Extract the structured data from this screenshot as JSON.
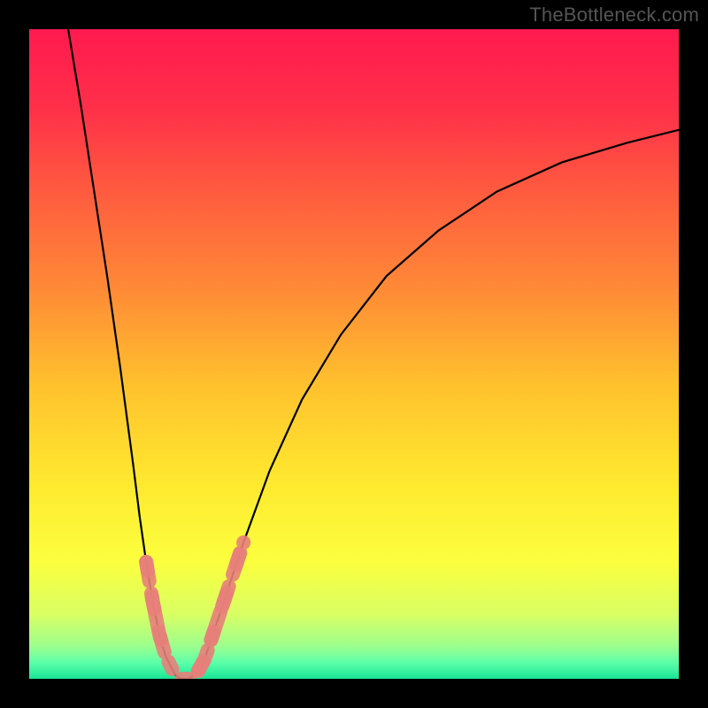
{
  "watermark": "TheBottleneck.com",
  "gradient_stops": [
    {
      "offset": 0.0,
      "color": "#ff1a4f"
    },
    {
      "offset": 0.12,
      "color": "#ff2f49"
    },
    {
      "offset": 0.25,
      "color": "#ff5b3f"
    },
    {
      "offset": 0.4,
      "color": "#ff8a36"
    },
    {
      "offset": 0.55,
      "color": "#ffc22d"
    },
    {
      "offset": 0.7,
      "color": "#ffe92f"
    },
    {
      "offset": 0.82,
      "color": "#fbff3e"
    },
    {
      "offset": 0.9,
      "color": "#d9ff63"
    },
    {
      "offset": 0.95,
      "color": "#9cff8e"
    },
    {
      "offset": 0.975,
      "color": "#5dffa9"
    },
    {
      "offset": 1.0,
      "color": "#19e696"
    }
  ],
  "chart_data": {
    "type": "line",
    "title": "",
    "xlabel": "",
    "ylabel": "",
    "xlim": [
      0,
      100
    ],
    "ylim": [
      0,
      100
    ],
    "series": [
      {
        "name": "left-curve",
        "x": [
          6,
          8,
          10,
          12,
          14,
          16,
          17,
          18,
          19,
          20,
          21,
          22,
          22.5,
          23,
          23.5
        ],
        "y": [
          100,
          88,
          75,
          62,
          48,
          33,
          25,
          18,
          12,
          7,
          3.5,
          1.5,
          0.6,
          0.2,
          0
        ]
      },
      {
        "name": "right-curve",
        "x": [
          24.5,
          25,
          26,
          27,
          28,
          30,
          33,
          37,
          42,
          48,
          55,
          63,
          72,
          82,
          92,
          100
        ],
        "y": [
          0,
          0.3,
          1.2,
          3,
          6,
          12,
          21,
          32,
          43,
          53,
          62,
          69,
          75,
          79.5,
          82.5,
          84.5
        ]
      },
      {
        "name": "flat-bottom",
        "x": [
          23.5,
          24.5
        ],
        "y": [
          0,
          0
        ]
      }
    ],
    "highlight_band": {
      "name": "salmon-markers",
      "description": "dashed salmon overlay along both curves roughly between y≈1 and y≈24",
      "color": "#e77f7a",
      "y_range": [
        1,
        24
      ]
    }
  }
}
